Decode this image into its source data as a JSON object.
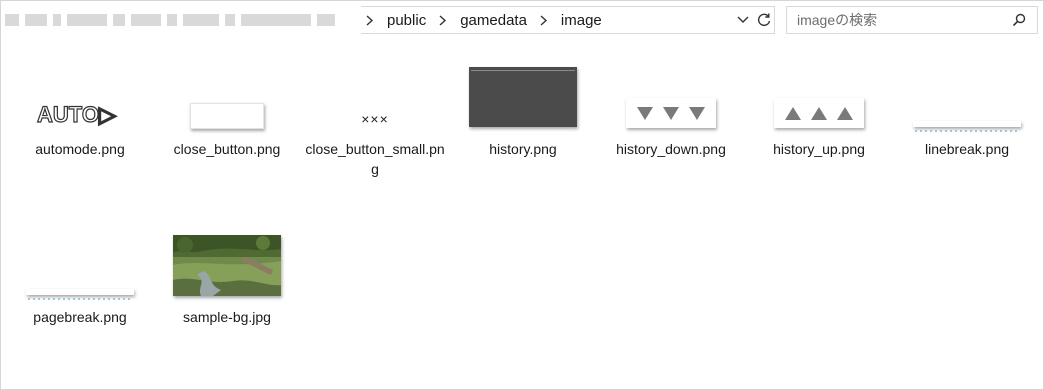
{
  "address": {
    "breadcrumbs": [
      "public",
      "gamedata",
      "image"
    ]
  },
  "search": {
    "placeholder": "imageの検索"
  },
  "files": [
    {
      "name": "automode.png",
      "thumb_text": "AUTO▷"
    },
    {
      "name": "close_button.png"
    },
    {
      "name": "close_button_small.png",
      "thumb_text": "×××"
    },
    {
      "name": "history.png"
    },
    {
      "name": "history_down.png"
    },
    {
      "name": "history_up.png"
    },
    {
      "name": "linebreak.png"
    },
    {
      "name": "pagebreak.png"
    },
    {
      "name": "sample-bg.jpg"
    }
  ],
  "icons": {
    "dropdown": "chevron-down-icon",
    "refresh": "refresh-icon",
    "search": "search-icon",
    "separator": "chevron-right-icon"
  },
  "colors": {
    "thumb_dark": "#4b4b4b",
    "triangle": "#7a7a7a",
    "dotted_line": "#9ec6d9"
  }
}
